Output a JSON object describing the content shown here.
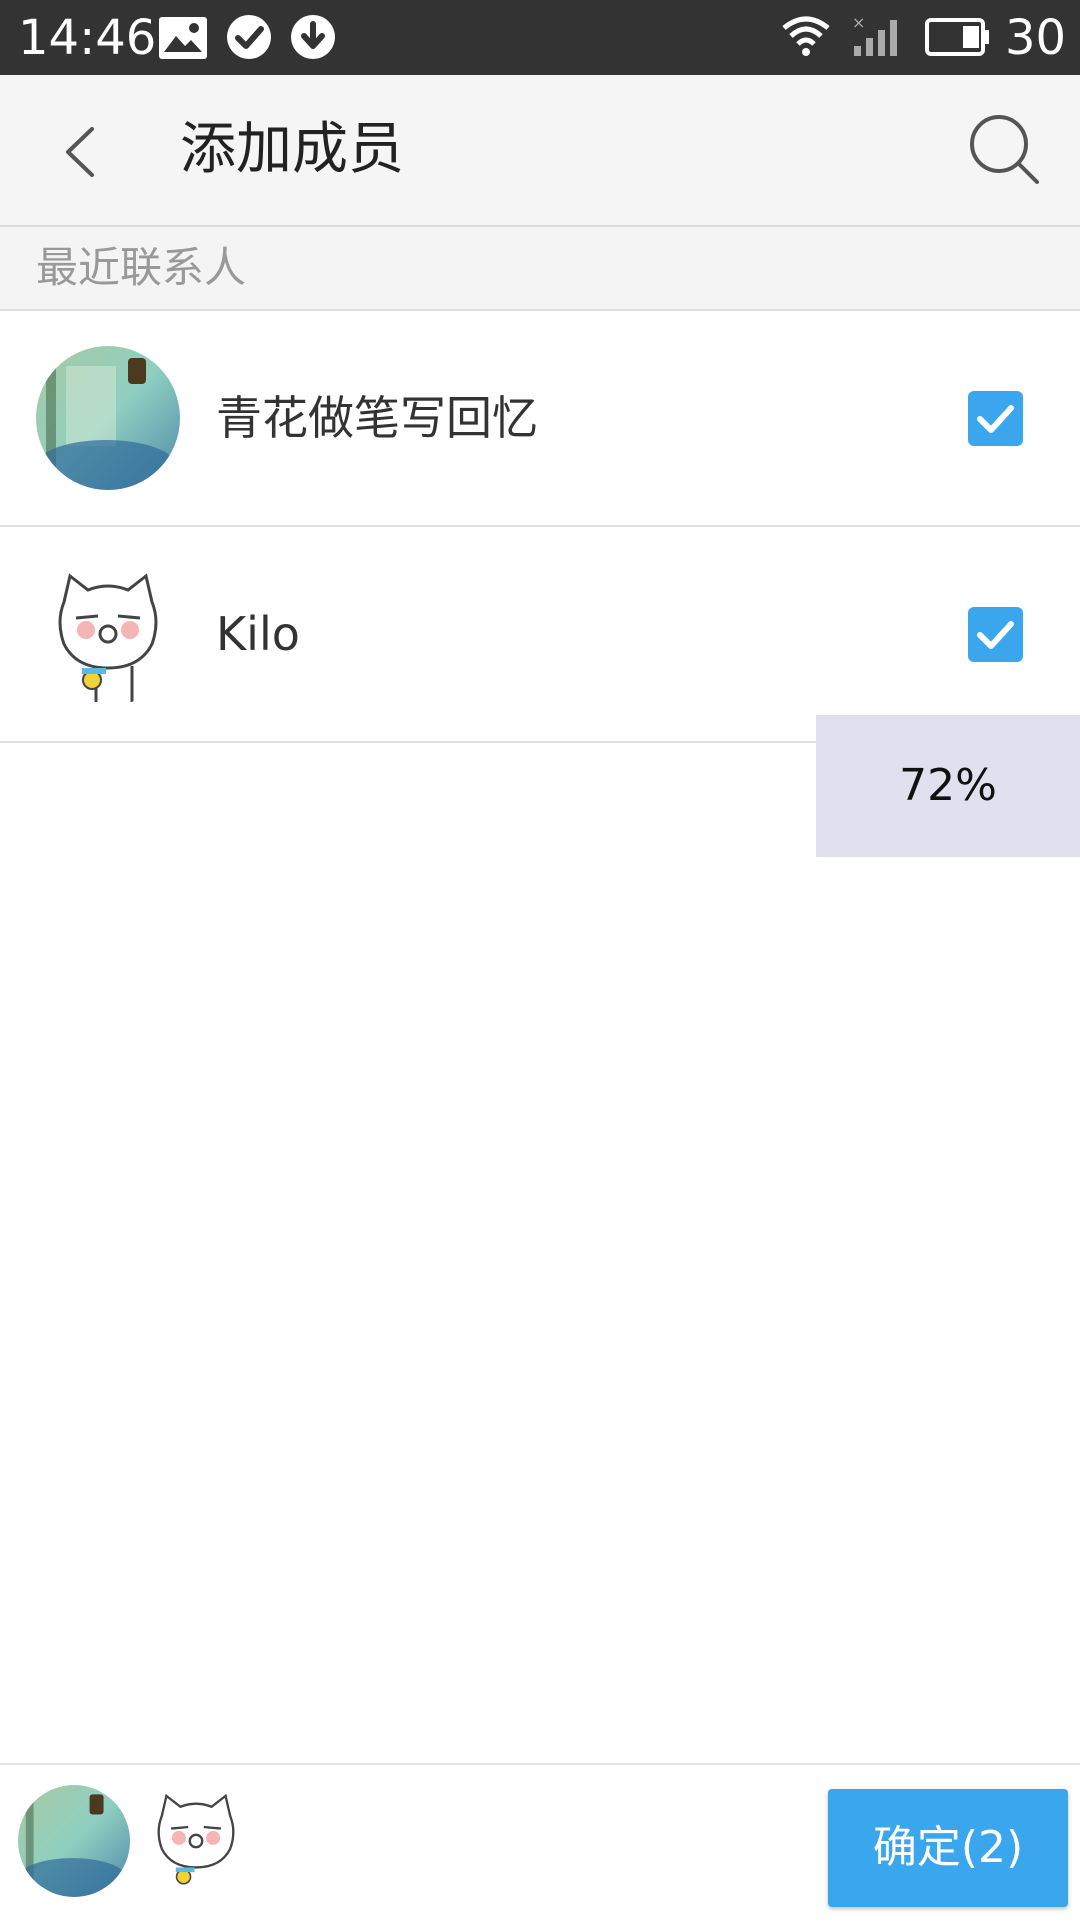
{
  "status_bar": {
    "time": "14:46",
    "battery_level": "30",
    "icons": [
      "image-icon",
      "check-circle-icon",
      "download-icon",
      "wifi-icon",
      "cell-signal-icon",
      "battery-icon"
    ]
  },
  "header": {
    "title": "添加成员",
    "back_icon": "chevron-left-icon",
    "search_icon": "search-icon"
  },
  "section": {
    "label": "最近联系人"
  },
  "contacts": [
    {
      "name": "青花做笔写回忆",
      "checked": true
    },
    {
      "name": "Kilo",
      "checked": true
    }
  ],
  "scroll_indicator": {
    "percent": "72%"
  },
  "footer": {
    "confirm_label": "确定(2)"
  },
  "colors": {
    "accent": "#3aa6ee",
    "status_bar": "#333333",
    "app_bar": "#f5f5f5"
  }
}
